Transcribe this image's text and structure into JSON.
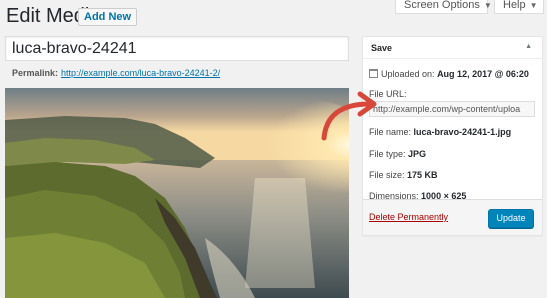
{
  "header": {
    "title": "Edit Media",
    "add_new_label": "Add New",
    "screen_options_label": "Screen Options",
    "help_label": "Help"
  },
  "media": {
    "title_value": "luca-bravo-24241",
    "permalink_label": "Permalink:",
    "permalink_url": "http://example.com/luca-bravo-24241-2/"
  },
  "save_box": {
    "heading": "Save",
    "uploaded_label": "Uploaded on:",
    "uploaded_value": "Aug 12, 2017 @ 06:20",
    "file_url_label": "File URL:",
    "file_url_value": "http://example.com/wp-content/uploa",
    "file_name_label": "File name:",
    "file_name_value": "luca-bravo-24241-1.jpg",
    "file_type_label": "File type:",
    "file_type_value": "JPG",
    "file_size_label": "File size:",
    "file_size_value": "175 KB",
    "dimensions_label": "Dimensions:",
    "dimensions_value": "1000 × 625",
    "delete_label": "Delete Permanently",
    "update_label": "Update"
  },
  "colors": {
    "accent": "#0085ba",
    "link": "#0073aa",
    "delete": "#aa0000",
    "annotation_arrow": "#d9473b"
  },
  "icons": [
    "calendar-icon",
    "collapse-caret-icon",
    "dropdown-caret-icon",
    "annotation-arrow"
  ]
}
